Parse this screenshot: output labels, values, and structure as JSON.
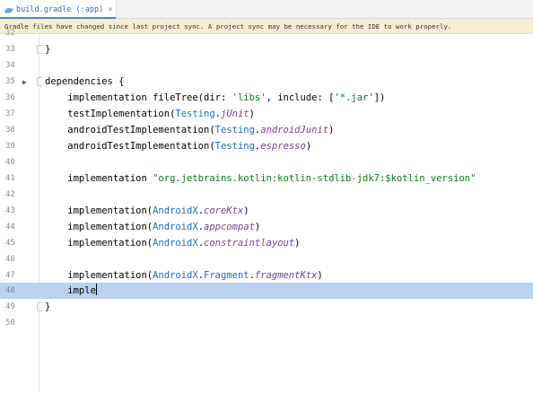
{
  "tab": {
    "title": "build.gradle (:app)",
    "close": "×"
  },
  "banner": {
    "text": "Gradle files have changed since last project sync. A project sync may be necessary for the IDE to work properly."
  },
  "editor": {
    "cropped_line": "32",
    "lines": [
      {
        "num": "33",
        "text": "}"
      },
      {
        "num": "34",
        "text": ""
      },
      {
        "num": "35",
        "text": "dependencies {"
      },
      {
        "num": "36",
        "text": "    implementation fileTree(dir: 'libs', include: ['*.jar'])"
      },
      {
        "num": "37",
        "text": "    testImplementation(Testing.jUnit)"
      },
      {
        "num": "38",
        "text": "    androidTestImplementation(Testing.androidJunit)"
      },
      {
        "num": "39",
        "text": "    androidTestImplementation(Testing.espresso)"
      },
      {
        "num": "40",
        "text": ""
      },
      {
        "num": "41",
        "text": "    implementation \"org.jetbrains.kotlin:kotlin-stdlib-jdk7:$kotlin_version\""
      },
      {
        "num": "42",
        "text": ""
      },
      {
        "num": "43",
        "text": "    implementation(AndroidX.coreKtx)"
      },
      {
        "num": "44",
        "text": "    implementation(AndroidX.appcompat)"
      },
      {
        "num": "45",
        "text": "    implementation(AndroidX.constraintlayout)"
      },
      {
        "num": "46",
        "text": ""
      },
      {
        "num": "47",
        "text": "    implementation(AndroidX.Fragment.fragmentKtx)"
      },
      {
        "num": "48",
        "text": "    imple"
      },
      {
        "num": "49",
        "text": "}"
      },
      {
        "num": "50",
        "text": ""
      }
    ],
    "current_line": "48"
  },
  "colors": {
    "current_line": "#b9d2f4",
    "class_ref": "#1c6ac2",
    "property": "#7a3e9d",
    "string": "#067d17",
    "banner_bg": "#f5eed2"
  },
  "icons": {
    "tab_icon": "gradle-icon",
    "fold": "run-gutter-icon"
  }
}
